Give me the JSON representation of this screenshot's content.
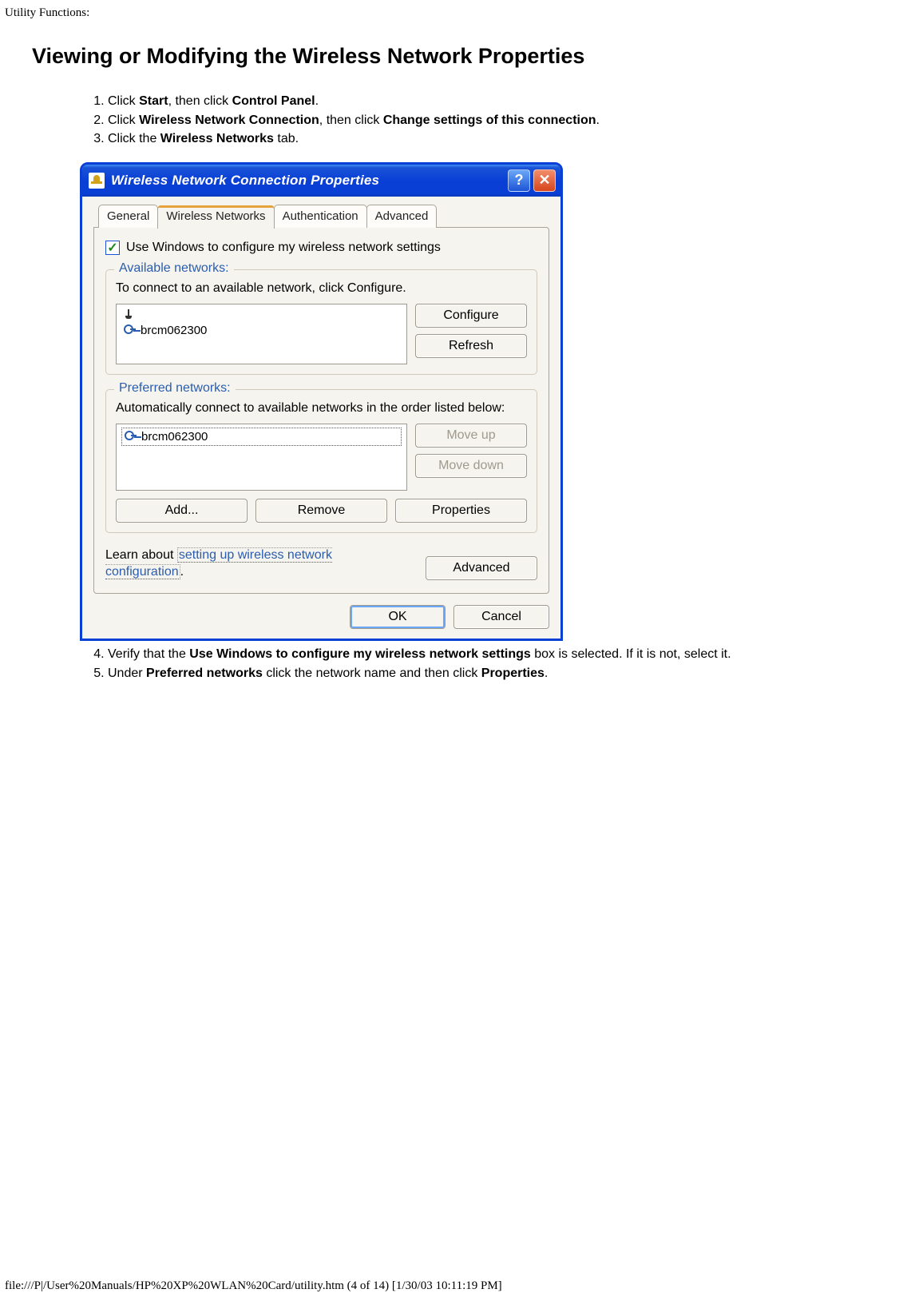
{
  "header": "Utility Functions:",
  "title": "Viewing or Modifying the Wireless Network Properties",
  "steps": {
    "s1": {
      "pre": "Click ",
      "b1": "Start",
      "mid1": ", then click ",
      "b2": "Control Panel",
      "post": "."
    },
    "s2": {
      "pre": "Click ",
      "b1": "Wireless Network Connection",
      "mid1": ", then click ",
      "b2": "Change settings of this connection",
      "post": "."
    },
    "s3": {
      "pre": "Click the ",
      "b1": "Wireless Networks",
      "post": " tab."
    },
    "s4": {
      "pre": "Verify that the ",
      "b1": "Use Windows to configure my wireless network settings",
      "post": " box is selected. If it is not, select it."
    },
    "s5": {
      "pre": "Under ",
      "b1": "Preferred networks",
      "mid1": " click the network name and then click ",
      "b2": "Properties",
      "post": "."
    }
  },
  "dialog": {
    "title": "Wireless Network Connection Properties",
    "tabs": {
      "general": "General",
      "wireless": "Wireless Networks",
      "auth": "Authentication",
      "advanced": "Advanced"
    },
    "checkbox_label": "Use Windows to configure my wireless network settings",
    "available": {
      "title": "Available networks:",
      "desc": "To connect to an available network, click Configure.",
      "item": "brcm062300",
      "configure": "Configure",
      "refresh": "Refresh"
    },
    "preferred": {
      "title": "Preferred networks:",
      "desc": "Automatically connect to available networks in the order listed below:",
      "item": "brcm062300",
      "moveup": "Move up",
      "movedown": "Move down",
      "add": "Add...",
      "remove": "Remove",
      "properties": "Properties"
    },
    "learn_pre": "Learn about ",
    "learn_link": "setting up wireless network configuration",
    "learn_post": ".",
    "advanced_btn": "Advanced",
    "ok": "OK",
    "cancel": "Cancel"
  },
  "footer": "file:///P|/User%20Manuals/HP%20XP%20WLAN%20Card/utility.htm (4 of 14) [1/30/03 10:11:19 PM]"
}
